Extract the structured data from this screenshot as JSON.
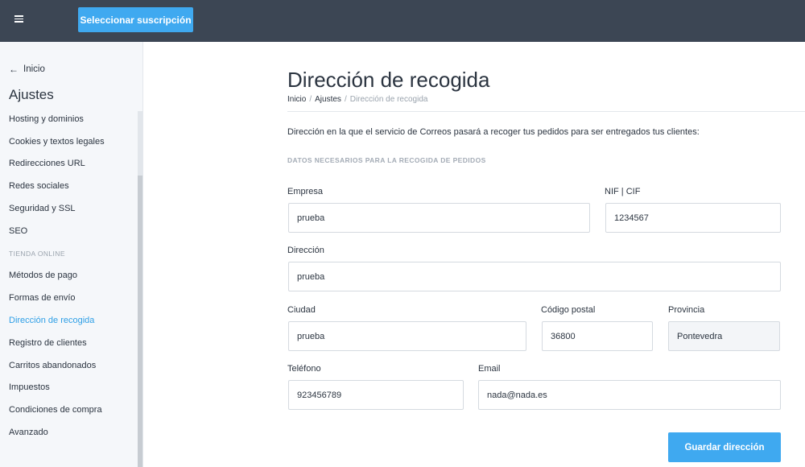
{
  "topbar": {
    "menu_icon": "hamburger-icon",
    "subscription_button": "Seleccionar suscripción"
  },
  "sidebar": {
    "back_icon": "arrow-left-icon",
    "back_label": "Inicio",
    "title": "Ajustes",
    "items": [
      {
        "type": "item",
        "label": "Hosting y dominios"
      },
      {
        "type": "item",
        "label": "Cookies y textos legales"
      },
      {
        "type": "item",
        "label": "Redirecciones URL"
      },
      {
        "type": "item",
        "label": "Redes sociales"
      },
      {
        "type": "item",
        "label": "Seguridad y SSL"
      },
      {
        "type": "item",
        "label": "SEO"
      },
      {
        "type": "section",
        "label": "TIENDA ONLINE"
      },
      {
        "type": "item",
        "label": "Métodos de pago"
      },
      {
        "type": "item",
        "label": "Formas de envío"
      },
      {
        "type": "item",
        "label": "Dirección de recogida",
        "active": true
      },
      {
        "type": "item",
        "label": "Registro de clientes"
      },
      {
        "type": "item",
        "label": "Carritos abandonados"
      },
      {
        "type": "item",
        "label": "Impuestos"
      },
      {
        "type": "item",
        "label": "Condiciones de compra"
      },
      {
        "type": "item",
        "label": "Avanzado"
      }
    ]
  },
  "main": {
    "title": "Dirección de recogida",
    "breadcrumb": {
      "home": "Inicio",
      "separator": "/",
      "parent": "Ajustes",
      "current": "Dirección de recogida"
    },
    "intro": "Dirección en la que el servicio de Correos pasará a recoger tus pedidos para ser entregados tus clientes:",
    "section_label": "DATOS NECESARIOS PARA LA RECOGIDA DE PEDIDOS",
    "fields": {
      "empresa": {
        "label": "Empresa",
        "value": "prueba"
      },
      "nif": {
        "label": "NIF | CIF",
        "value": "1234567"
      },
      "direccion": {
        "label": "Dirección",
        "value": "prueba"
      },
      "ciudad": {
        "label": "Ciudad",
        "value": "prueba"
      },
      "codigo_postal": {
        "label": "Código postal",
        "value": "36800"
      },
      "provincia": {
        "label": "Provincia",
        "value": "Pontevedra"
      },
      "telefono": {
        "label": "Teléfono",
        "value": "923456789"
      },
      "email": {
        "label": "Email",
        "value": "nada@nada.es"
      }
    },
    "save_button": "Guardar dirección"
  },
  "colors": {
    "topbar": "#3c4654",
    "accent": "#3fa9f0",
    "active_link": "#2e9fe6",
    "sidebar_bg": "#f5f7fa"
  }
}
